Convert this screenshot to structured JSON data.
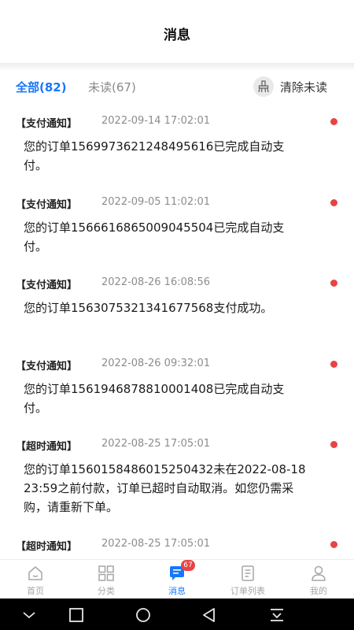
{
  "header": {
    "title": "消息"
  },
  "filter": {
    "all_label": "全部(82)",
    "unread_label": "未读(67)",
    "clear_label": "清除未读"
  },
  "messages": [
    {
      "tag": "【支付通知】",
      "time": "2022-09-14 17:02:01",
      "body": "您的订单1569973621248495616已完成自动支付。",
      "unread": true
    },
    {
      "tag": "【支付通知】",
      "time": "2022-09-05 11:02:01",
      "body": "您的订单1566616865009045504已完成自动支付。",
      "unread": true
    },
    {
      "tag": "【支付通知】",
      "time": "2022-08-26 16:08:56",
      "body": "您的订单1563075321341677568支付成功。",
      "unread": true
    },
    {
      "tag": "【支付通知】",
      "time": "2022-08-26 09:32:01",
      "body": "您的订单1561946878810001408已完成自动支付。",
      "unread": true
    },
    {
      "tag": "【超时通知】",
      "time": "2022-08-25 17:05:01",
      "body": "您的订单1560158486015250432未在2022-08-18 23:59之前付款，订单已超时自动取消。如您仍需采购，请重新下单。",
      "unread": true
    },
    {
      "tag": "【超时通知】",
      "time": "2022-08-25 17:05:01",
      "body": "",
      "unread": true
    }
  ],
  "tabbar": {
    "home": "首页",
    "category": "分类",
    "messages": "消息",
    "messages_badge": "67",
    "orders": "订单列表",
    "mine": "我的"
  },
  "colors": {
    "accent": "#1677ff",
    "unread_dot": "#e84343",
    "muted": "#8c8c8c"
  }
}
